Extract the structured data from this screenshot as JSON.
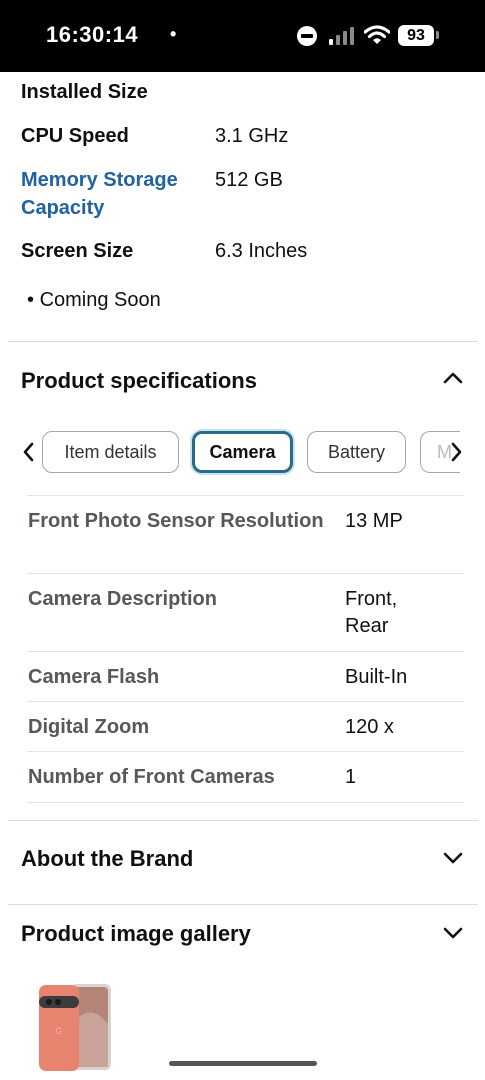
{
  "status_bar": {
    "time": "16:30:14",
    "dot": "•",
    "battery": "93"
  },
  "details": {
    "rows": [
      {
        "label": "Installed Size",
        "value": ""
      },
      {
        "label": "CPU Speed",
        "value": "3.1 GHz"
      },
      {
        "label": "Memory Storage Capacity",
        "value": "512 GB"
      },
      {
        "label": "Screen Size",
        "value": "6.3 Inches"
      }
    ],
    "bullet": "Coming Soon"
  },
  "product_specs": {
    "title": "Product specifications",
    "tabs": [
      "Item details",
      "Camera",
      "Battery",
      "M"
    ],
    "active_tab": "Camera",
    "rows": [
      {
        "label": "Front Photo Sensor Resolution",
        "value": "13 MP"
      },
      {
        "label": "Camera Description",
        "value": "Front, Rear"
      },
      {
        "label": "Camera Flash",
        "value": "Built-In"
      },
      {
        "label": "Digital Zoom",
        "value": "120 x"
      },
      {
        "label": "Number of Front Cameras",
        "value": "1"
      }
    ]
  },
  "about_brand": {
    "title": "About the Brand"
  },
  "gallery": {
    "title": "Product image gallery"
  },
  "colors": {
    "link": "#2162a1",
    "active_tab_border": "#2a6a8a",
    "phone_body": "#e7846f"
  }
}
